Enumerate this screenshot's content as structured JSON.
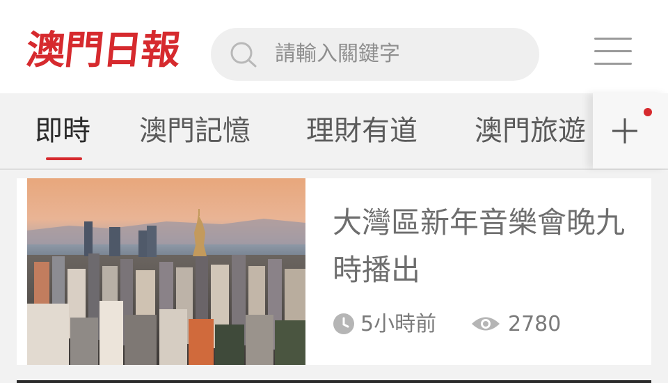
{
  "header": {
    "logo_text": "澳門日報",
    "search": {
      "placeholder": "請輸入關鍵字",
      "icon": "search-icon"
    },
    "menu_icon": "hamburger-menu-icon"
  },
  "tabs": {
    "items": [
      {
        "label": "即時",
        "active": true
      },
      {
        "label": "澳門記憶",
        "active": false
      },
      {
        "label": "理財有道",
        "active": false
      },
      {
        "label": "澳門旅遊",
        "active": false
      }
    ],
    "add_icon": "plus-icon",
    "notification_dot_color": "#d62a2e"
  },
  "news": [
    {
      "title": "大灣區新年音樂會晚九時播出",
      "time": "5小時前",
      "views": "2780",
      "thumbnail": "macau-skyline-sunset-photo"
    }
  ],
  "colors": {
    "brand_red": "#d62a2e",
    "background": "#f2f2f2",
    "card": "#ffffff"
  }
}
